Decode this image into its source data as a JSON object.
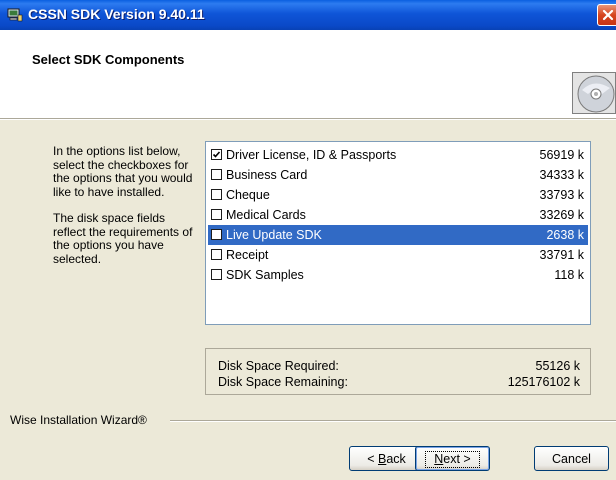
{
  "window": {
    "title": "CSSN SDK Version 9.40.11",
    "icon": "setup-computer-icon",
    "close_icon": "close-x-icon"
  },
  "header": {
    "title": "Select SDK Components",
    "icon": "cd-disc-icon"
  },
  "description": {
    "paragraph1": "In the options list below, select the checkboxes for the options that you would like to have installed.",
    "paragraph2": "The disk space fields reflect the requirements of the options you have selected."
  },
  "components": [
    {
      "label": "Driver License, ID & Passports",
      "size": "56919 k",
      "checked": true,
      "selected": false
    },
    {
      "label": "Business Card",
      "size": "34333 k",
      "checked": false,
      "selected": false
    },
    {
      "label": "Cheque",
      "size": "33793 k",
      "checked": false,
      "selected": false
    },
    {
      "label": "Medical Cards",
      "size": "33269 k",
      "checked": false,
      "selected": false
    },
    {
      "label": "Live Update SDK",
      "size": "2638 k",
      "checked": false,
      "selected": true
    },
    {
      "label": "Receipt",
      "size": "33791 k",
      "checked": false,
      "selected": false
    },
    {
      "label": "SDK Samples",
      "size": "118 k",
      "checked": false,
      "selected": false
    }
  ],
  "disk_space": {
    "required_label": "Disk Space Required:",
    "required_value": "55126 k",
    "remaining_label": "Disk Space Remaining:",
    "remaining_value": "125176102 k"
  },
  "footer": {
    "brand": "Wise Installation Wizard®",
    "back_prefix": "< ",
    "back_key": "B",
    "back_rest": "ack",
    "next_key": "N",
    "next_rest": "ext >",
    "cancel_label": "Cancel"
  },
  "colors": {
    "titlebar": "#0a49c8",
    "selection": "#316ac5",
    "dialog_bg": "#ece9d8"
  }
}
